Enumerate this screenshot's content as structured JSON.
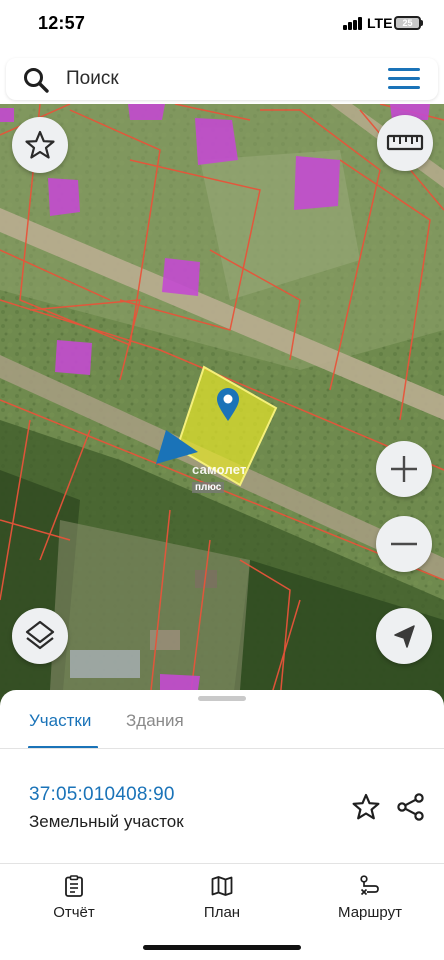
{
  "status_bar": {
    "time": "12:57",
    "network": "LTE",
    "battery": "25"
  },
  "search": {
    "placeholder": "Поиск",
    "icon": "search-icon",
    "menu_icon": "hamburger-menu-icon"
  },
  "map": {
    "watermark_line1": "самолет",
    "watermark_line2": "плюс",
    "controls": [
      "star-icon",
      "ruler-icon",
      "zoom-in-icon",
      "zoom-out-icon",
      "layers-icon",
      "locate-icon"
    ],
    "selected_parcel_color": "#e6e62a",
    "parcel_border_color": "#e8543a",
    "building_color": "#c34ad0"
  },
  "sheet": {
    "tabs": [
      {
        "label": "Участки",
        "active": true
      },
      {
        "label": "Здания",
        "active": false
      }
    ],
    "parcel": {
      "number": "37:05:010408:90",
      "type": "Земельный участок"
    }
  },
  "bottom_nav": [
    {
      "label": "Отчёт",
      "icon": "report-icon"
    },
    {
      "label": "План",
      "icon": "map-plan-icon"
    },
    {
      "label": "Маршрут",
      "icon": "route-icon"
    }
  ],
  "colors": {
    "accent": "#1a73b8",
    "text": "#1f1f1f",
    "muted": "#8a8a8a"
  }
}
